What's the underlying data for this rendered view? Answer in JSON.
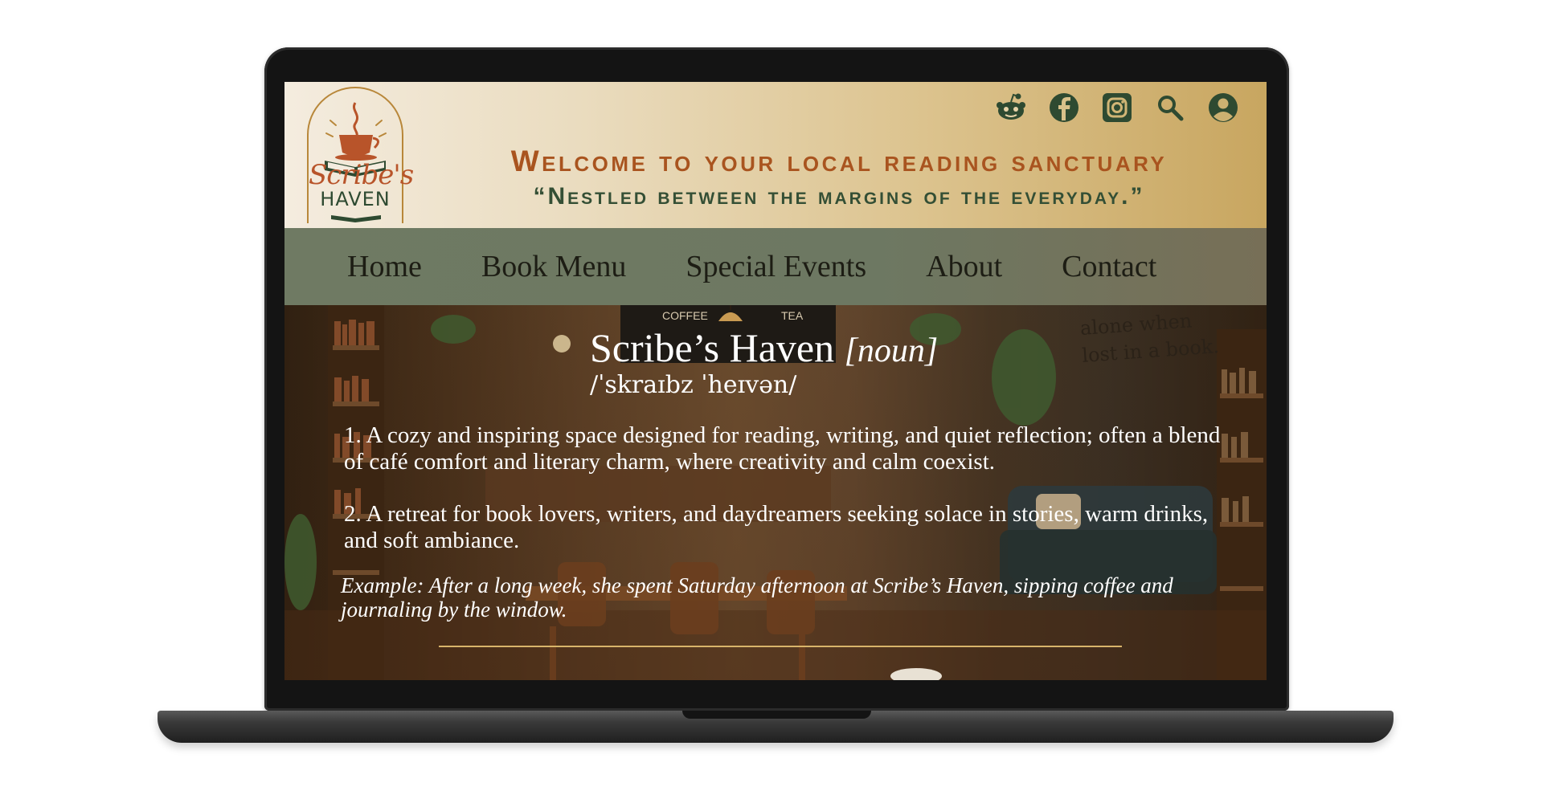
{
  "site": {
    "logo": {
      "script": "Scribe's",
      "word": "HAVEN"
    },
    "header_icons": [
      "reddit-icon",
      "facebook-icon",
      "instagram-icon",
      "search-icon",
      "account-icon"
    ],
    "tagline": {
      "main": "Welcome to your local reading sanctuary",
      "sub": "“Nestled between the margins of the everyday.”"
    },
    "nav": [
      "Home",
      "Book Menu",
      "Special Events",
      "About",
      "Contact"
    ],
    "hero": {
      "quote_fragment": [
        "alone when",
        "lost in a book."
      ],
      "cafe_signs": [
        "COFFEE",
        "TEA"
      ],
      "definition": {
        "term": "Scribe’s Haven",
        "part_of_speech": "[noun]",
        "pronunciation": "/ˈskraɪbz ˈheɪvən/",
        "meanings": [
          "1.  A cozy and inspiring space designed for reading, writing, and quiet reflection; often a blend of café comfort and literary charm, where creativity and calm coexist.",
          "2.  A retreat for book lovers, writers, and daydreamers seeking solace in stories, warm drinks, and soft ambiance."
        ],
        "example": "Example: After a long week, she spent Saturday afternoon at Scribe’s Haven, sipping coffee and journaling by the window."
      }
    },
    "colors": {
      "header_start": "#f4ecdf",
      "header_end": "#c8a660",
      "tagline_main": "#a9541f",
      "tagline_sub": "#344f35",
      "nav_bg": "#6f7a63",
      "icon_green": "#2e4a31",
      "divider_gold": "#d8b46a"
    }
  }
}
